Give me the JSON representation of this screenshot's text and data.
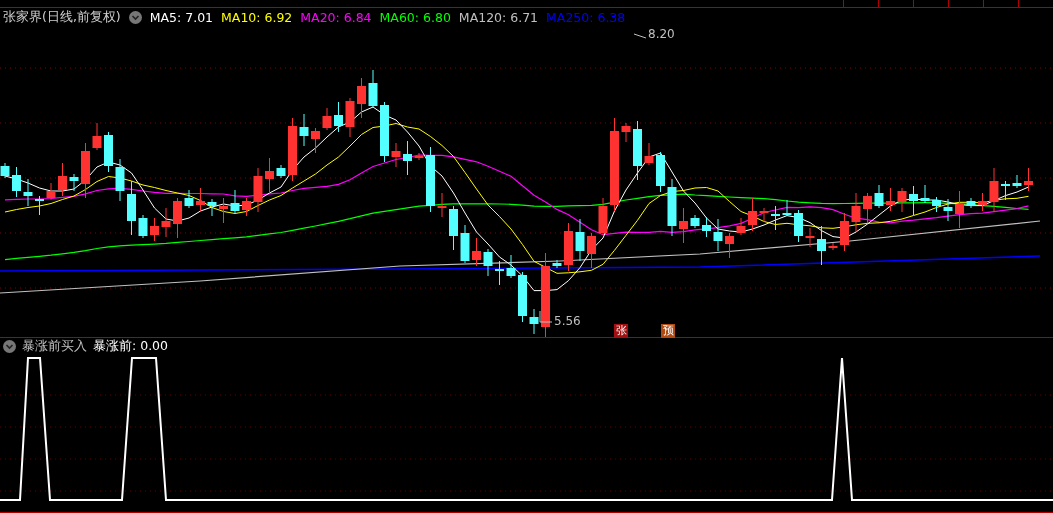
{
  "header": {
    "title": "张家界(日线,前复权)",
    "moving_averages": [
      {
        "label": "MA5: 7.01",
        "color": "#ffffff"
      },
      {
        "label": "MA10: 6.92",
        "color": "#ffff00"
      },
      {
        "label": "MA20: 6.84",
        "color": "#ff00ff"
      },
      {
        "label": "MA60: 6.80",
        "color": "#00ff00"
      },
      {
        "label": "MA120: 6.71",
        "color": "#c0c0c0"
      },
      {
        "label": "MA250: 6.38",
        "color": "#0000ff"
      }
    ]
  },
  "price_chart": {
    "high_label": "8.20",
    "low_label": "5.56",
    "signals": [
      {
        "text": "张",
        "color": "#a01010"
      },
      {
        "text": "预",
        "color": "#b04a10"
      }
    ]
  },
  "indicator": {
    "name": "暴涨前买入",
    "value": "暴涨前: 0.00"
  }
}
